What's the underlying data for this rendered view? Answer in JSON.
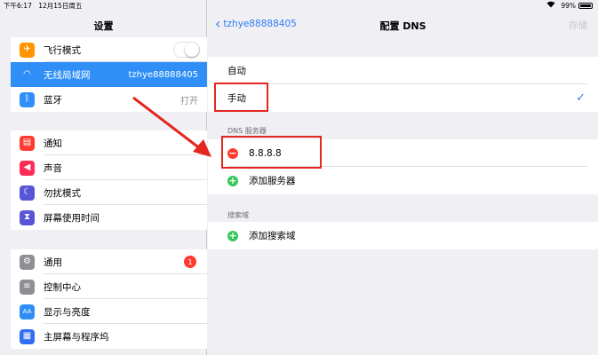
{
  "status_bar": {
    "time": "下午6:17",
    "date": "12月15日周五",
    "battery": "99%",
    "battery_level": 0.99
  },
  "settings": {
    "title": "设置",
    "groups": [
      {
        "items": [
          {
            "label": "飞行模式",
            "icon": "airplane-icon",
            "color": "#ff9500",
            "control": "toggle-off"
          },
          {
            "label": "无线局域网",
            "icon": "wifi-icon",
            "color": "#2f8ff7",
            "value": "tzhye88888405",
            "selected": true
          },
          {
            "label": "蓝牙",
            "icon": "bluetooth-icon",
            "color": "#2f8ff7",
            "value": "打开"
          }
        ]
      },
      {
        "items": [
          {
            "label": "通知",
            "icon": "notifications-icon",
            "color": "#ff3b30"
          },
          {
            "label": "声音",
            "icon": "sound-icon",
            "color": "#ff2d55"
          },
          {
            "label": "勿扰模式",
            "icon": "moon-icon",
            "color": "#5856d6"
          },
          {
            "label": "屏幕使用时间",
            "icon": "hourglass-icon",
            "color": "#5856d6"
          }
        ]
      },
      {
        "items": [
          {
            "label": "通用",
            "icon": "gear-icon",
            "color": "#8e8e93",
            "badge": "1"
          },
          {
            "label": "控制中心",
            "icon": "toggles-icon",
            "color": "#8e8e93"
          },
          {
            "label": "显示与亮度",
            "icon": "display-aa-icon",
            "color": "#2f8ff7"
          },
          {
            "label": "主屏幕与程序坞",
            "icon": "home-grid-icon",
            "color": "#2f6ff0"
          }
        ]
      }
    ]
  },
  "dns": {
    "back_label": "tzhye88888405",
    "title": "配置 DNS",
    "save_label": "存储",
    "mode_auto": "自动",
    "mode_manual": "手动",
    "servers_header": "DNS 服务器",
    "server": "8.8.8.8",
    "add_server": "添加服务器",
    "search_header": "搜索域",
    "add_search_domain": "添加搜索域"
  },
  "colors": {
    "accent": "#2f7cf6",
    "highlight": "#e4261f",
    "delete": "#ff3b30",
    "add": "#34c759"
  }
}
